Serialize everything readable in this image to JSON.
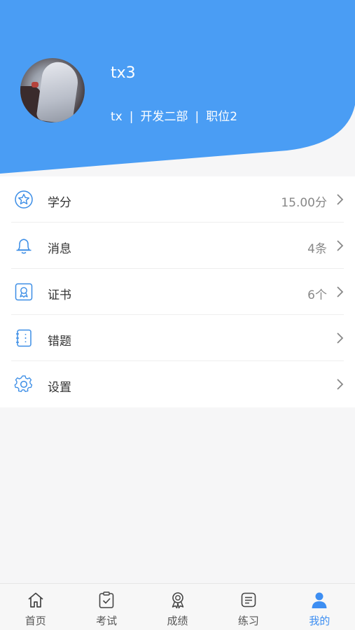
{
  "colors": {
    "primary": "#4a9df4",
    "active_tab": "#3d8ef2"
  },
  "profile": {
    "name": "tx3",
    "account": "tx",
    "department": "开发二部",
    "position": "职位2",
    "separator": "|"
  },
  "menu": [
    {
      "icon": "star-icon",
      "label": "学分",
      "value": "15.00分"
    },
    {
      "icon": "bell-icon",
      "label": "消息",
      "value": "4条"
    },
    {
      "icon": "certificate-icon",
      "label": "证书",
      "value": "6个"
    },
    {
      "icon": "notebook-icon",
      "label": "错题",
      "value": ""
    },
    {
      "icon": "gear-icon",
      "label": "设置",
      "value": ""
    }
  ],
  "tabs": [
    {
      "icon": "home-icon",
      "label": "首页",
      "active": false
    },
    {
      "icon": "exam-icon",
      "label": "考试",
      "active": false
    },
    {
      "icon": "medal-icon",
      "label": "成绩",
      "active": false
    },
    {
      "icon": "practice-icon",
      "label": "练习",
      "active": false
    },
    {
      "icon": "user-icon",
      "label": "我的",
      "active": true
    }
  ]
}
